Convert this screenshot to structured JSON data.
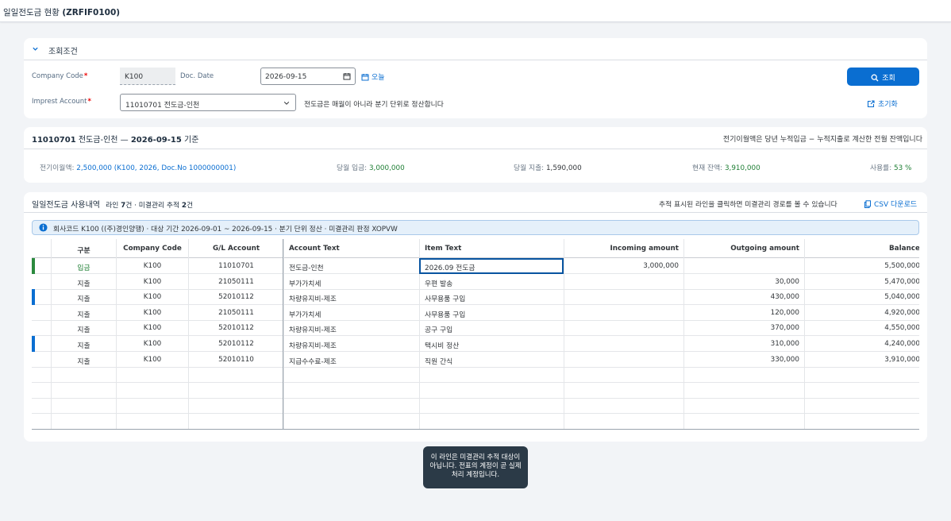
{
  "app": {
    "title_prefix": "일일전도금 현황",
    "title_code": "(ZRFIF0100)"
  },
  "filter": {
    "section_title": "조회조건",
    "company_code_label": "Company Code",
    "company_code_value": "K100",
    "doc_date_label": "Doc. Date",
    "doc_date_value": "2026-09-15",
    "today_label": "오늘",
    "imprest_label": "Imprest Account",
    "imprest_value": "11010701 전도금-인천",
    "hint": "전도금은 매월이 아니라 분기 단위로 정산합니다",
    "search_label": "조회",
    "reset_label": "초기화"
  },
  "summary": {
    "title_account": "11010701",
    "title_name": "전도금-인천 —",
    "title_date": "2026-09-15",
    "title_suffix": "기준",
    "note": "전기이월액은 당년 누적입금 − 누적지출로 계산한 전월 잔액입니다",
    "carry_label": "전기이월액:",
    "carry_value": "2,500,000 (K100, 2026, Doc.No 1000000001)",
    "incoming_label": "당월 입금:",
    "incoming_value": "3,000,000",
    "outgoing_label": "당월 지출:",
    "outgoing_value": "1,590,000",
    "balance_label": "현재 잔액:",
    "balance_value": "3,910,000",
    "usage_label": "사용률:",
    "usage_value": "53 %"
  },
  "table": {
    "title": "일일전도금 사용내역",
    "sub_prefix": "라인",
    "line_count": "7",
    "sub_mid": "건 · 미결관리 추적",
    "track_count": "2",
    "sub_suffix": "건",
    "note": "추적 표시된 라인을 클릭하면 미결관리 경로를 볼 수 있습니다",
    "csv_label": "CSV 다운로드",
    "info": "회사코드 K100 ((주)경인양행) · 대상 기간 2026-09-01 ~ 2026-09-15 · 분기 단위 정산 · 미결관리 판정 XOPVW",
    "columns": [
      "구분",
      "Company Code",
      "G/L Account",
      "Account Text",
      "Item Text",
      "Incoming amount",
      "Outgoing amount",
      "Balance"
    ],
    "rows": [
      {
        "type": "입금",
        "cc": "K100",
        "gl": "11010701",
        "acct": "전도금-인천",
        "item": "2026.09 전도금",
        "in": "3,000,000",
        "out": "",
        "bal": "5,500,000"
      },
      {
        "type": "지출",
        "cc": "K100",
        "gl": "21050111",
        "acct": "부가가치세",
        "item": "우편 발송",
        "in": "",
        "out": "30,000",
        "bal": "5,470,000"
      },
      {
        "type": "지출",
        "cc": "K100",
        "gl": "52010112",
        "acct": "차량유지비-제조",
        "item": "사무용품 구입",
        "in": "",
        "out": "430,000",
        "bal": "5,040,000"
      },
      {
        "type": "지출",
        "cc": "K100",
        "gl": "21050111",
        "acct": "부가가치세",
        "item": "사무용품 구입",
        "in": "",
        "out": "120,000",
        "bal": "4,920,000"
      },
      {
        "type": "지출",
        "cc": "K100",
        "gl": "52010112",
        "acct": "차량유지비-제조",
        "item": "공구 구입",
        "in": "",
        "out": "370,000",
        "bal": "4,550,000"
      },
      {
        "type": "지출",
        "cc": "K100",
        "gl": "52010112",
        "acct": "차량유지비-제조",
        "item": "택시비 정산",
        "in": "",
        "out": "310,000",
        "bal": "4,240,000"
      },
      {
        "type": "지출",
        "cc": "K100",
        "gl": "52010110",
        "acct": "지급수수료-제조",
        "item": "직원 간식",
        "in": "",
        "out": "330,000",
        "bal": "3,910,000"
      }
    ]
  },
  "tooltip": {
    "text": "이 라인은 미결관리 추적 대상이 아닙니다. 전표의 계정이 곧 실제 처리 계정입니다."
  },
  "colors": {
    "accent": "#0a6ed1",
    "incoming": "#1e7e34",
    "track_mark": "#0a6ed1",
    "incoming_mark": "#2b8a3e"
  }
}
